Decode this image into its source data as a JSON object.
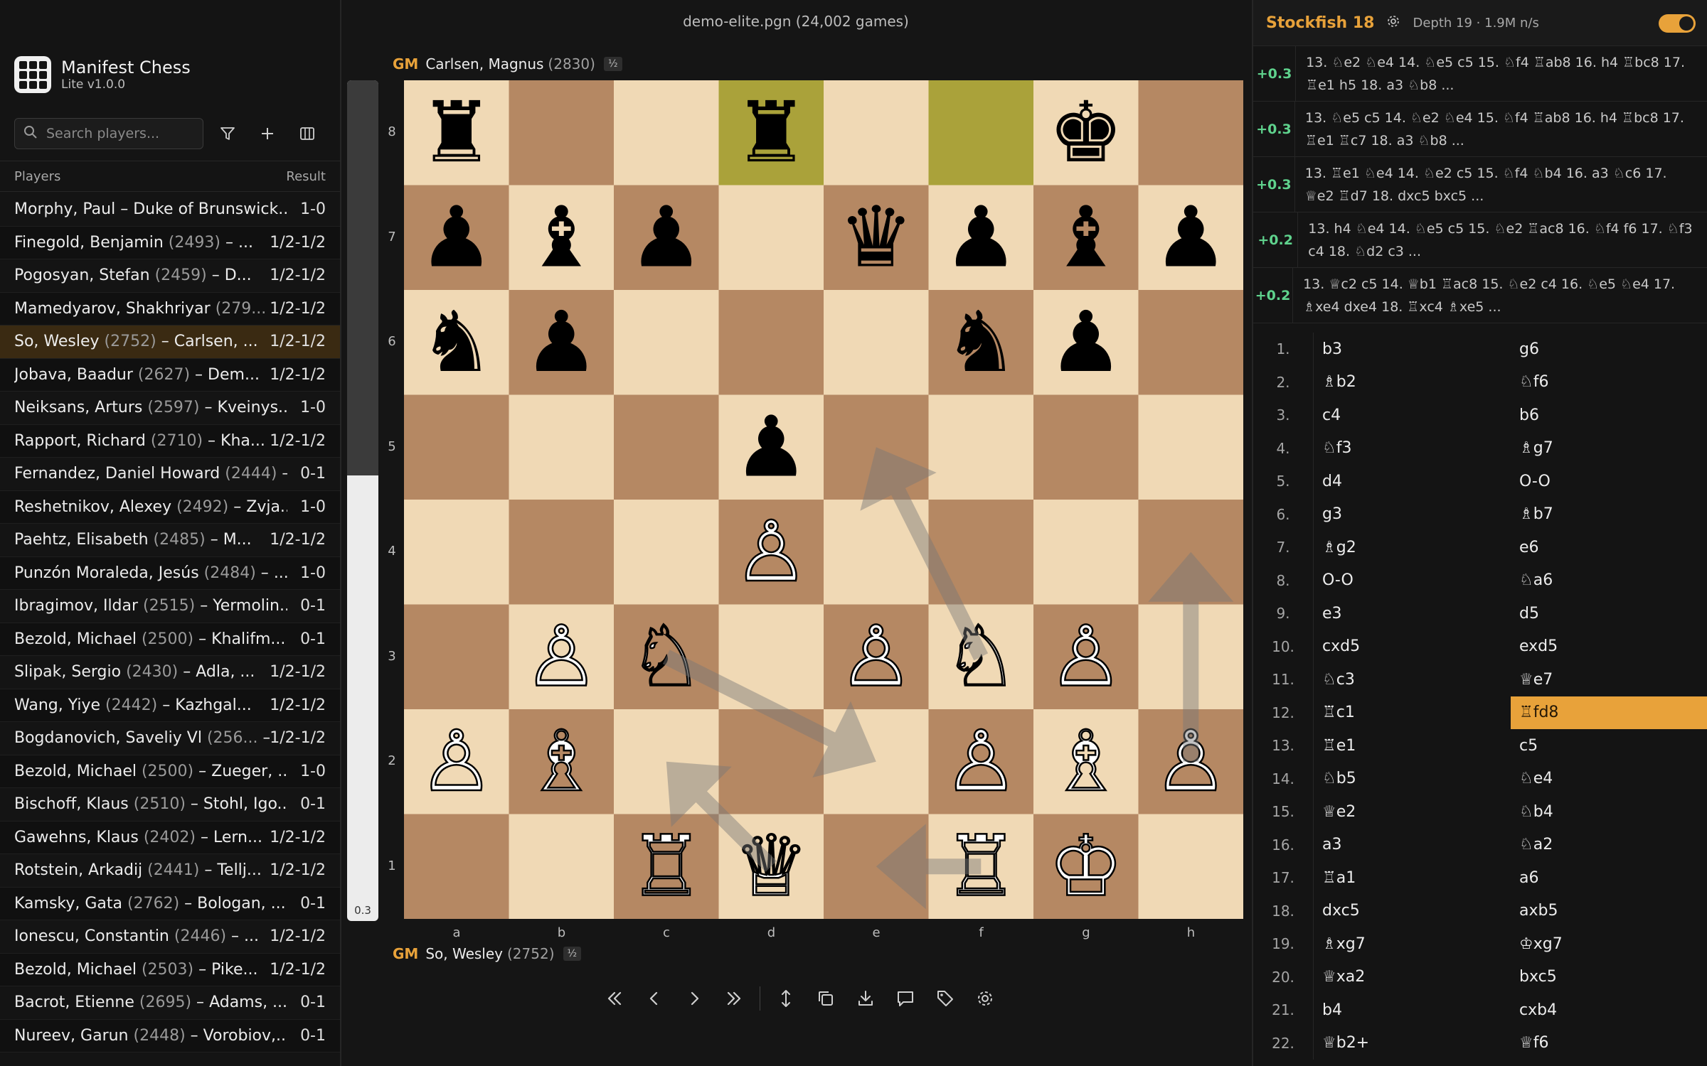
{
  "app": {
    "name": "Manifest Chess",
    "version": "Lite v1.0.0"
  },
  "search": {
    "placeholder": "Search players..."
  },
  "list_header": {
    "players": "Players",
    "result": "Result"
  },
  "games": [
    {
      "white": "Morphy, Paul",
      "white_elo": "",
      "black": "Duke of Brunswick...",
      "black_elo": "",
      "result": "1-0"
    },
    {
      "white": "Finegold, Benjamin",
      "white_elo": "(2493)",
      "black": "...",
      "black_elo": "",
      "result": "1/2-1/2"
    },
    {
      "white": "Pogosyan, Stefan",
      "white_elo": "(2459)",
      "black": "D...",
      "black_elo": "",
      "result": "1/2-1/2"
    },
    {
      "white": "Mamedyarov, Shakhriyar",
      "white_elo": "(279...",
      "black": "",
      "black_elo": "",
      "result": "1/2-1/2"
    },
    {
      "white": "So, Wesley",
      "white_elo": "(2752)",
      "black": "Carlsen, ...",
      "black_elo": "",
      "result": "1/2-1/2",
      "selected": true
    },
    {
      "white": "Jobava, Baadur",
      "white_elo": "(2627)",
      "black": "Dem...",
      "black_elo": "",
      "result": "1/2-1/2"
    },
    {
      "white": "Neiksans, Arturs",
      "white_elo": "(2597)",
      "black": "Kveinys...",
      "black_elo": "",
      "result": "1-0"
    },
    {
      "white": "Rapport, Richard",
      "white_elo": "(2710)",
      "black": "Kha...",
      "black_elo": "",
      "result": "1/2-1/2"
    },
    {
      "white": "Fernandez, Daniel Howard",
      "white_elo": "(2444)",
      "black": "...",
      "black_elo": "",
      "result": "0-1"
    },
    {
      "white": "Reshetnikov, Alexey",
      "white_elo": "(2492)",
      "black": "Zvja...",
      "black_elo": "",
      "result": "1-0"
    },
    {
      "white": "Paehtz, Elisabeth",
      "white_elo": "(2485)",
      "black": "M...",
      "black_elo": "",
      "result": "1/2-1/2"
    },
    {
      "white": "Punzón Moraleda, Jesús",
      "white_elo": "(2484)",
      "black": "...",
      "black_elo": "",
      "result": "1-0"
    },
    {
      "white": "Ibragimov, Ildar",
      "white_elo": "(2515)",
      "black": "Yermolin...",
      "black_elo": "",
      "result": "0-1"
    },
    {
      "white": "Bezold, Michael",
      "white_elo": "(2500)",
      "black": "Khalifm...",
      "black_elo": "",
      "result": "0-1"
    },
    {
      "white": "Slipak, Sergio",
      "white_elo": "(2430)",
      "black": "Adla, ...",
      "black_elo": "",
      "result": "1/2-1/2"
    },
    {
      "white": "Wang, Yiye",
      "white_elo": "(2442)",
      "black": "Kazhgal...",
      "black_elo": "",
      "result": "1/2-1/2"
    },
    {
      "white": "Bogdanovich, Saveliy Vl",
      "white_elo": "(256...",
      "black": "",
      "black_elo": "",
      "result": "1/2-1/2"
    },
    {
      "white": "Bezold, Michael",
      "white_elo": "(2500)",
      "black": "Zueger, ...",
      "black_elo": "",
      "result": "1-0"
    },
    {
      "white": "Bischoff, Klaus",
      "white_elo": "(2510)",
      "black": "Stohl, Igo...",
      "black_elo": "",
      "result": "0-1"
    },
    {
      "white": "Gawehns, Klaus",
      "white_elo": "(2402)",
      "black": "Lern...",
      "black_elo": "",
      "result": "1/2-1/2"
    },
    {
      "white": "Rotstein, Arkadij",
      "white_elo": "(2441)",
      "black": "Tellj...",
      "black_elo": "",
      "result": "1/2-1/2"
    },
    {
      "white": "Kamsky, Gata",
      "white_elo": "(2762)",
      "black": "Bologan, ...",
      "black_elo": "",
      "result": "0-1"
    },
    {
      "white": "Ionescu, Constantin",
      "white_elo": "(2446)",
      "black": "...",
      "black_elo": "",
      "result": "1/2-1/2"
    },
    {
      "white": "Bezold, Michael",
      "white_elo": "(2503)",
      "black": "Pike...",
      "black_elo": "",
      "result": "1/2-1/2"
    },
    {
      "white": "Bacrot, Etienne",
      "white_elo": "(2695)",
      "black": "Adams, ...",
      "black_elo": "",
      "result": "0-1"
    },
    {
      "white": "Nureev, Garun",
      "white_elo": "(2448)",
      "black": "Vorobiov,...",
      "black_elo": "",
      "result": "0-1"
    }
  ],
  "database": {
    "title": "demo-elite.pgn (24,002 games)"
  },
  "top_player": {
    "title": "GM",
    "name": "Carlsen, Magnus",
    "elo": "(2830)",
    "score": "½"
  },
  "bottom_player": {
    "title": "GM",
    "name": "So, Wesley",
    "elo": "(2752)",
    "score": "½"
  },
  "eval_bar": {
    "text": "0.3",
    "black_share": 0.47
  },
  "board": {
    "files": [
      "a",
      "b",
      "c",
      "d",
      "e",
      "f",
      "g",
      "h"
    ],
    "ranks": [
      "8",
      "7",
      "6",
      "5",
      "4",
      "3",
      "2",
      "1"
    ],
    "light_color": "#f0d9b5",
    "dark_color": "#b58863",
    "highlight_color": "#aaa23a",
    "highlights": [
      "d8",
      "f8"
    ],
    "pieces": [
      {
        "sq": "a8",
        "piece": "♜",
        "color": "black"
      },
      {
        "sq": "d8",
        "piece": "♜",
        "color": "black"
      },
      {
        "sq": "g8",
        "piece": "♚",
        "color": "black"
      },
      {
        "sq": "a7",
        "piece": "♟",
        "color": "black"
      },
      {
        "sq": "b7",
        "piece": "♝",
        "color": "black"
      },
      {
        "sq": "c7",
        "piece": "♟",
        "color": "black"
      },
      {
        "sq": "e7",
        "piece": "♛",
        "color": "black"
      },
      {
        "sq": "f7",
        "piece": "♟",
        "color": "black"
      },
      {
        "sq": "g7",
        "piece": "♝",
        "color": "black"
      },
      {
        "sq": "h7",
        "piece": "♟",
        "color": "black"
      },
      {
        "sq": "a6",
        "piece": "♞",
        "color": "black"
      },
      {
        "sq": "b6",
        "piece": "♟",
        "color": "black"
      },
      {
        "sq": "f6",
        "piece": "♞",
        "color": "black"
      },
      {
        "sq": "g6",
        "piece": "♟",
        "color": "black"
      },
      {
        "sq": "d5",
        "piece": "♟",
        "color": "black"
      },
      {
        "sq": "d4",
        "piece": "♙",
        "color": "white"
      },
      {
        "sq": "b3",
        "piece": "♙",
        "color": "white"
      },
      {
        "sq": "c3",
        "piece": "♘",
        "color": "white"
      },
      {
        "sq": "e3",
        "piece": "♙",
        "color": "white"
      },
      {
        "sq": "f3",
        "piece": "♘",
        "color": "white"
      },
      {
        "sq": "g3",
        "piece": "♙",
        "color": "white"
      },
      {
        "sq": "a2",
        "piece": "♙",
        "color": "white"
      },
      {
        "sq": "b2",
        "piece": "♗",
        "color": "white"
      },
      {
        "sq": "f2",
        "piece": "♙",
        "color": "white"
      },
      {
        "sq": "g2",
        "piece": "♗",
        "color": "white"
      },
      {
        "sq": "h2",
        "piece": "♙",
        "color": "white"
      },
      {
        "sq": "c1",
        "piece": "♖",
        "color": "white"
      },
      {
        "sq": "d1",
        "piece": "♕",
        "color": "white"
      },
      {
        "sq": "f1",
        "piece": "♖",
        "color": "white"
      },
      {
        "sq": "g1",
        "piece": "♔",
        "color": "white"
      }
    ],
    "arrows": [
      {
        "from": "f3",
        "to": "e5"
      },
      {
        "from": "c3",
        "to": "e2"
      },
      {
        "from": "d1",
        "to": "c2"
      },
      {
        "from": "f1",
        "to": "e1"
      },
      {
        "from": "h2",
        "to": "h4"
      }
    ]
  },
  "engine": {
    "name": "Stockfish 18",
    "depth": "Depth 19 · 1.9M n/s",
    "enabled": true,
    "lines": [
      {
        "score": "+0.3",
        "moves": "13. ♘e2 ♘e4 14. ♘e5 c5 15. ♘f4 ♖ab8 16. h4 ♖bc8 17. ♖e1 h5 18. a3 ♘b8 ..."
      },
      {
        "score": "+0.3",
        "moves": "13. ♘e5 c5 14. ♘e2 ♘e4 15. ♘f4 ♖ab8 16. h4 ♖bc8 17. ♖e1 ♖c7 18. a3 ♘b8 ..."
      },
      {
        "score": "+0.3",
        "moves": "13. ♖e1 ♘e4 14. ♘e2 c5 15. ♘f4 ♘b4 16. a3 ♘c6 17. ♕e2 ♖d7 18. dxc5 bxc5 ..."
      },
      {
        "score": "+0.2",
        "moves": "13. h4 ♘e4 14. ♘e5 c5 15. ♘e2 ♖ac8 16. ♘f4 f6 17. ♘f3 c4 18. ♘d2 c3 ..."
      },
      {
        "score": "+0.2",
        "moves": "13. ♕c2 c5 14. ♕b1 ♖ac8 15. ♘e2 c4 16. ♘e5 ♘e4 17. ♗xe4 dxe4 18. ♖xc4 ♗xe5 ..."
      }
    ]
  },
  "moves": [
    {
      "n": "1.",
      "w": "b3",
      "b": "g6"
    },
    {
      "n": "2.",
      "w": "♗b2",
      "b": "♘f6"
    },
    {
      "n": "3.",
      "w": "c4",
      "b": "b6"
    },
    {
      "n": "4.",
      "w": "♘f3",
      "b": "♗g7"
    },
    {
      "n": "5.",
      "w": "d4",
      "b": "O-O"
    },
    {
      "n": "6.",
      "w": "g3",
      "b": "♗b7"
    },
    {
      "n": "7.",
      "w": "♗g2",
      "b": "e6"
    },
    {
      "n": "8.",
      "w": "O-O",
      "b": "♘a6"
    },
    {
      "n": "9.",
      "w": "e3",
      "b": "d5"
    },
    {
      "n": "10.",
      "w": "cxd5",
      "b": "exd5"
    },
    {
      "n": "11.",
      "w": "♘c3",
      "b": "♕e7"
    },
    {
      "n": "12.",
      "w": "♖c1",
      "b": "♖fd8",
      "current": true
    },
    {
      "n": "13.",
      "w": "♖e1",
      "b": "c5"
    },
    {
      "n": "14.",
      "w": "♘b5",
      "b": "♘e4"
    },
    {
      "n": "15.",
      "w": "♕e2",
      "b": "♘b4"
    },
    {
      "n": "16.",
      "w": "a3",
      "b": "♘a2"
    },
    {
      "n": "17.",
      "w": "♖a1",
      "b": "a6"
    },
    {
      "n": "18.",
      "w": "dxc5",
      "b": "axb5"
    },
    {
      "n": "19.",
      "w": "♗xg7",
      "b": "♔xg7"
    },
    {
      "n": "20.",
      "w": "♕xa2",
      "b": "bxc5"
    },
    {
      "n": "21.",
      "w": "b4",
      "b": "cxb4"
    },
    {
      "n": "22.",
      "w": "♕b2+",
      "b": "♕f6"
    }
  ]
}
